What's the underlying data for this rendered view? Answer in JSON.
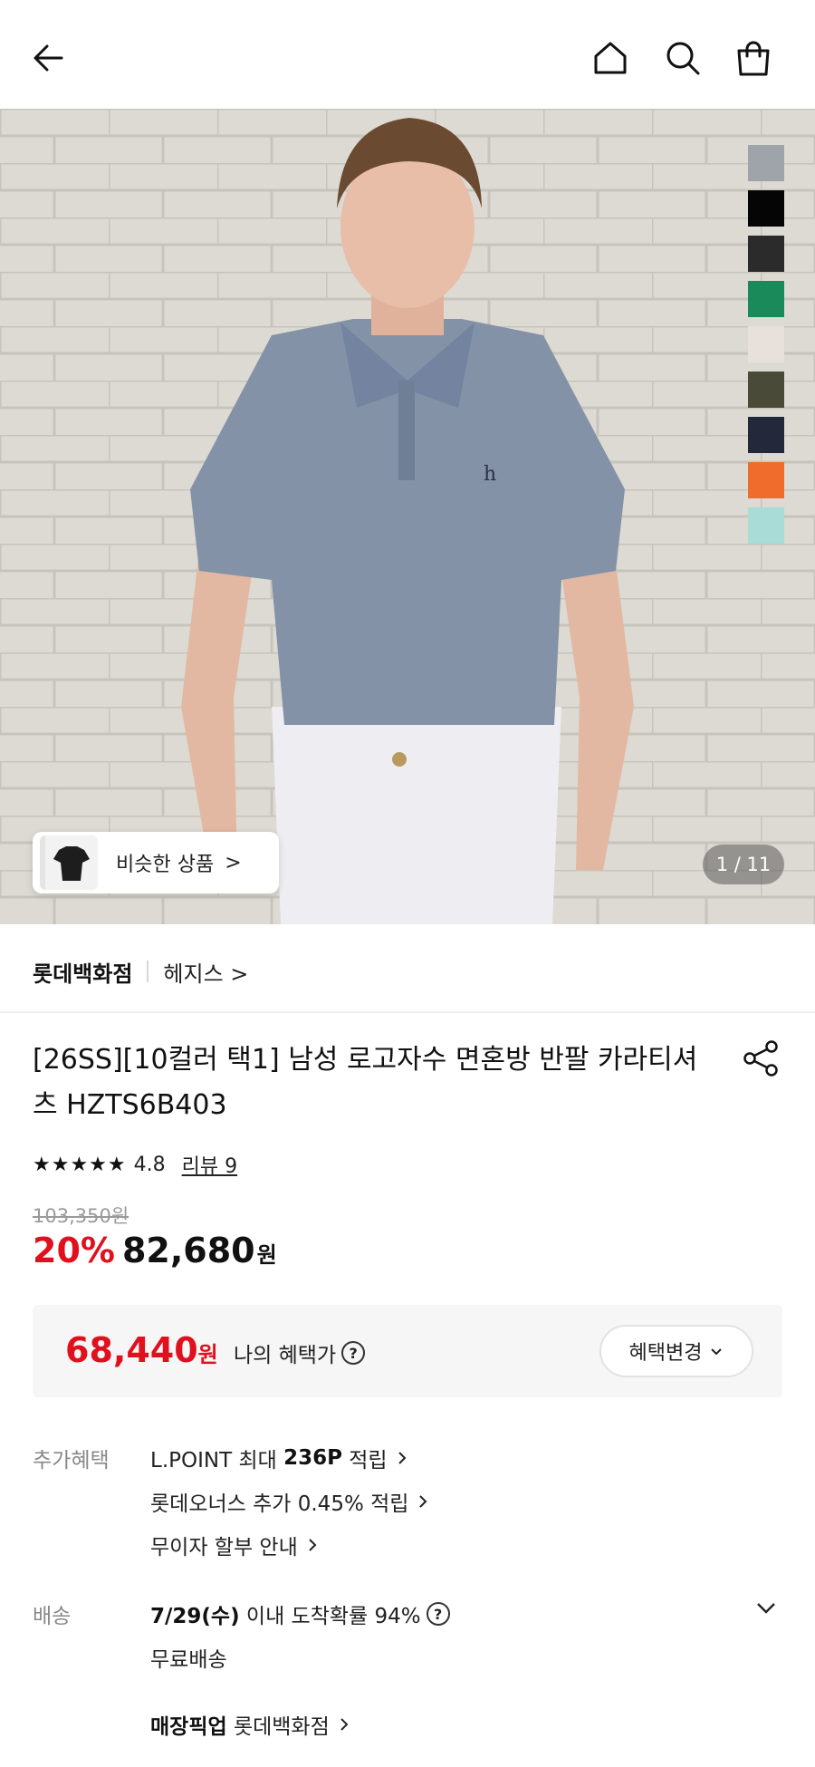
{
  "header": {
    "back_icon": "arrow-left-icon",
    "home_icon": "home-icon",
    "search_icon": "search-icon",
    "bag_icon": "shopping-bag-icon"
  },
  "gallery": {
    "swatch_colors": [
      "#9fa3aa",
      "#050505",
      "#2b2b2b",
      "#1a8a5a",
      "#e8e0db",
      "#4a4a38",
      "#23283a",
      "#f06c2c",
      "#a9dcd6"
    ],
    "similar_label": "비슷한 상품",
    "similar_chevron": ">",
    "counter": "1 / 11"
  },
  "store": {
    "name": "롯데백화점",
    "brand": "헤지스 >"
  },
  "product": {
    "title": "[26SS][10컬러 택1] 남성 로고자수 면혼방 반팔 카라티셔츠 HZTS6B403",
    "stars": "★★★★★",
    "rating": "4.8",
    "review": "리뷰 9",
    "original_price": "103,350원",
    "discount": "20%",
    "price": "82,680",
    "won": "원"
  },
  "benefit": {
    "price": "68,440",
    "won": "원",
    "label": "나의 혜택가",
    "help": "?",
    "button": "혜택변경"
  },
  "extra": {
    "label": "추가혜택",
    "lpoint_prefix": "L.POINT 최대 ",
    "lpoint_bold": "236P",
    "lpoint_suffix": " 적립",
    "line2": "롯데오너스 추가 0.45% 적립",
    "line3": "무이자 할부 안내"
  },
  "delivery": {
    "label": "배송",
    "date_bold": "7/29(수)",
    "date_rest": " 이내 도착확률 94%",
    "help": "?",
    "free": "무료배송",
    "pickup_bold": "매장픽업",
    "pickup_rest": " 롯데백화점"
  }
}
